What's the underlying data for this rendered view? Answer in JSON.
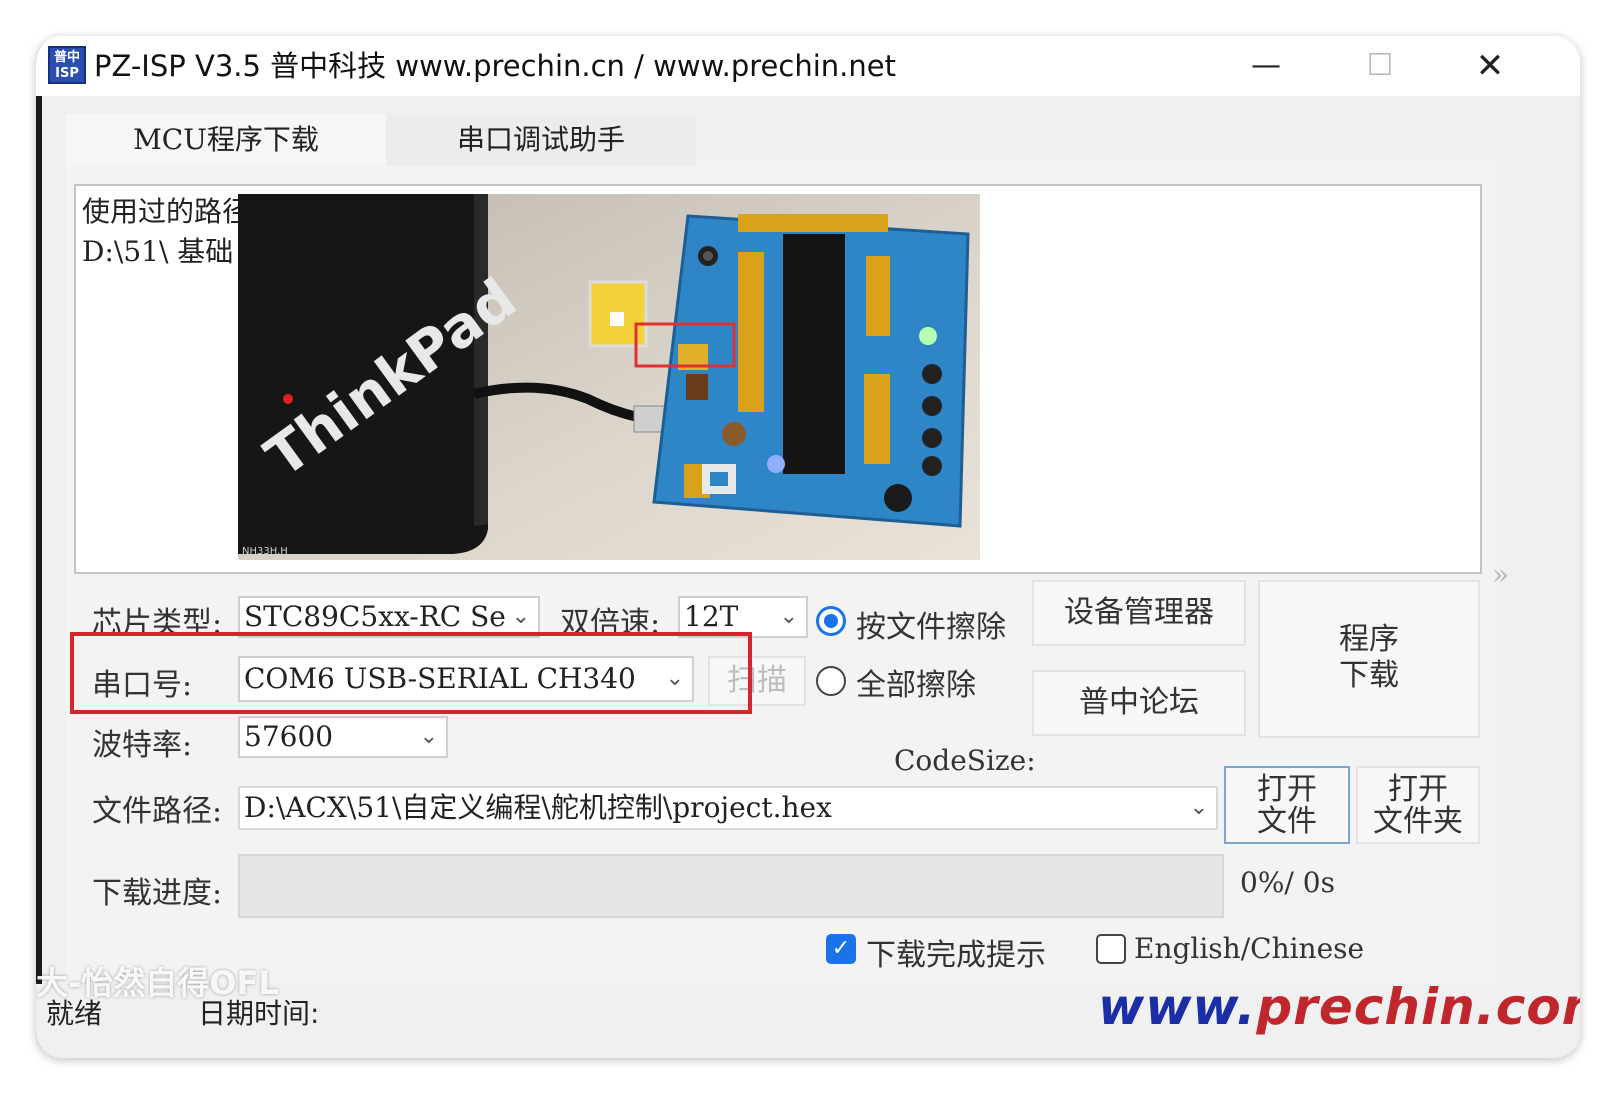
{
  "window": {
    "icon_text": "普中ISP",
    "title": "PZ-ISP V3.5 普中科技  www.prechin.cn / www.prechin.net",
    "minimize": "—",
    "maximize": "☐",
    "close": "✕"
  },
  "tabs": [
    {
      "label": "MCU程序下载",
      "active": true
    },
    {
      "label": "串口调试助手",
      "active": false
    }
  ],
  "log": {
    "line1": "使用过的路径",
    "line2": "D:\\51\\ 基础"
  },
  "photo": {
    "laptop_brand": "ThinkPad",
    "laptop_badge": "NH33H.H"
  },
  "expand_arrows": "»",
  "form": {
    "chip_type_label": "芯片类型:",
    "chip_type_value": "STC89C5xx-RC Se",
    "double_speed_label": "双倍速:",
    "double_speed_value": "12T",
    "erase_by_file_label": "按文件擦除",
    "erase_all_label": "全部擦除",
    "erase_mode": "by_file",
    "device_manager_button": "设备管理器",
    "forum_button": "普中论坛",
    "program_download_line1": "程序",
    "program_download_line2": "下载",
    "serial_port_label": "串口号:",
    "serial_port_value": "COM6   USB-SERIAL CH340",
    "scan_button": "扫描",
    "baud_rate_label": "波特率:",
    "baud_rate_value": "57600",
    "code_size_label": "CodeSize:",
    "file_path_label": "文件路径:",
    "file_path_value": "D:\\ACX\\51\\自定义编程\\舵机控制\\project.hex",
    "open_file_line1": "打开",
    "open_file_line2": "文件",
    "open_folder_line1": "打开",
    "open_folder_line2": "文件夹",
    "download_progress_label": "下载进度:",
    "progress_fraction": 0,
    "progress_text": "0%/  0s",
    "download_complete_label": "下载完成提示",
    "download_complete_checked": true,
    "english_chinese_label": "English/Chinese",
    "english_chinese_checked": false
  },
  "status_bar": {
    "watermark": "大-怡然自得OFL",
    "ready": "就绪",
    "datetime_label": "日期时间:",
    "brand_url_prefix": "www.",
    "brand_url_domain": "prechin.com"
  },
  "colors": {
    "highlight_box": "#d7262b",
    "accent": "#1a73e8",
    "brand_blue": "#1b2ea5",
    "brand_red": "#c0272d"
  }
}
